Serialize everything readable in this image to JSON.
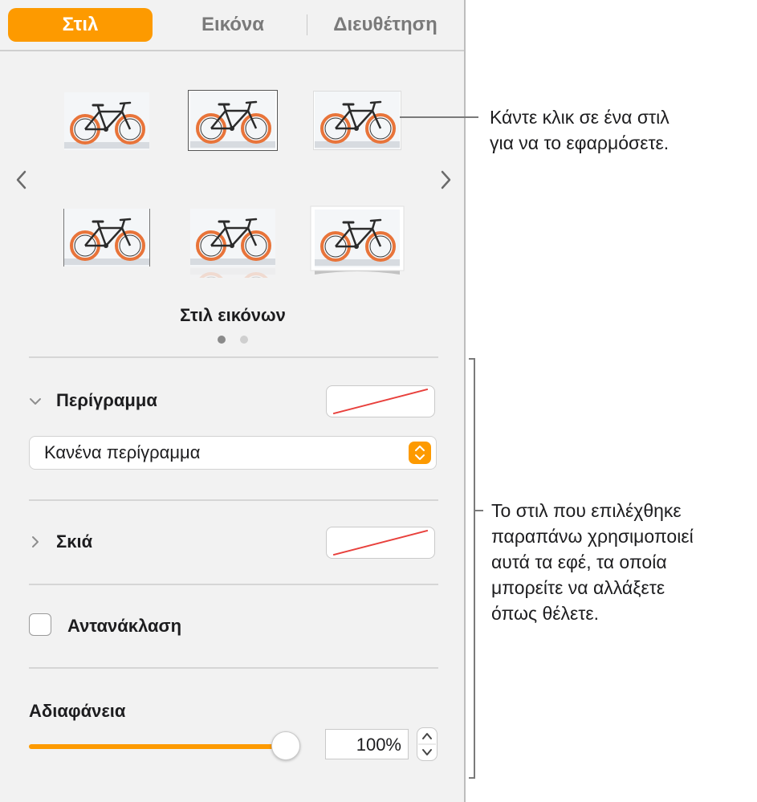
{
  "tabs": [
    {
      "label": "Στιλ",
      "active": true
    },
    {
      "label": "Εικόνα",
      "active": false
    },
    {
      "label": "Διευθέτηση",
      "active": false
    }
  ],
  "styles": {
    "label": "Στιλ εικόνων",
    "page_count": 2,
    "current_page": 1
  },
  "border": {
    "title": "Περίγραμμα",
    "select_value": "Κανένα περίγραμμα",
    "expanded": true
  },
  "shadow": {
    "title": "Σκιά",
    "expanded": false
  },
  "reflection": {
    "label": "Αντανάκλαση",
    "checked": false
  },
  "opacity": {
    "title": "Αδιαφάνεια",
    "value_text": "100%",
    "level": 1.0
  },
  "callouts": {
    "top_line1": "Κάντε κλικ σε ένα στιλ",
    "top_line2": "για να το εφαρμόσετε.",
    "bottom_line1": "Το στιλ που επιλέχθηκε",
    "bottom_line2": "παραπάνω χρησιμοποιεί",
    "bottom_line3": "αυτά τα εφέ, τα οποία",
    "bottom_line4": "μπορείτε να αλλάξετε",
    "bottom_line5": "όπως θέλετε."
  },
  "colors": {
    "accent": "#fd9a00",
    "panel_bg": "#f2f2f2",
    "no_fill_slash": "#e8403c"
  }
}
